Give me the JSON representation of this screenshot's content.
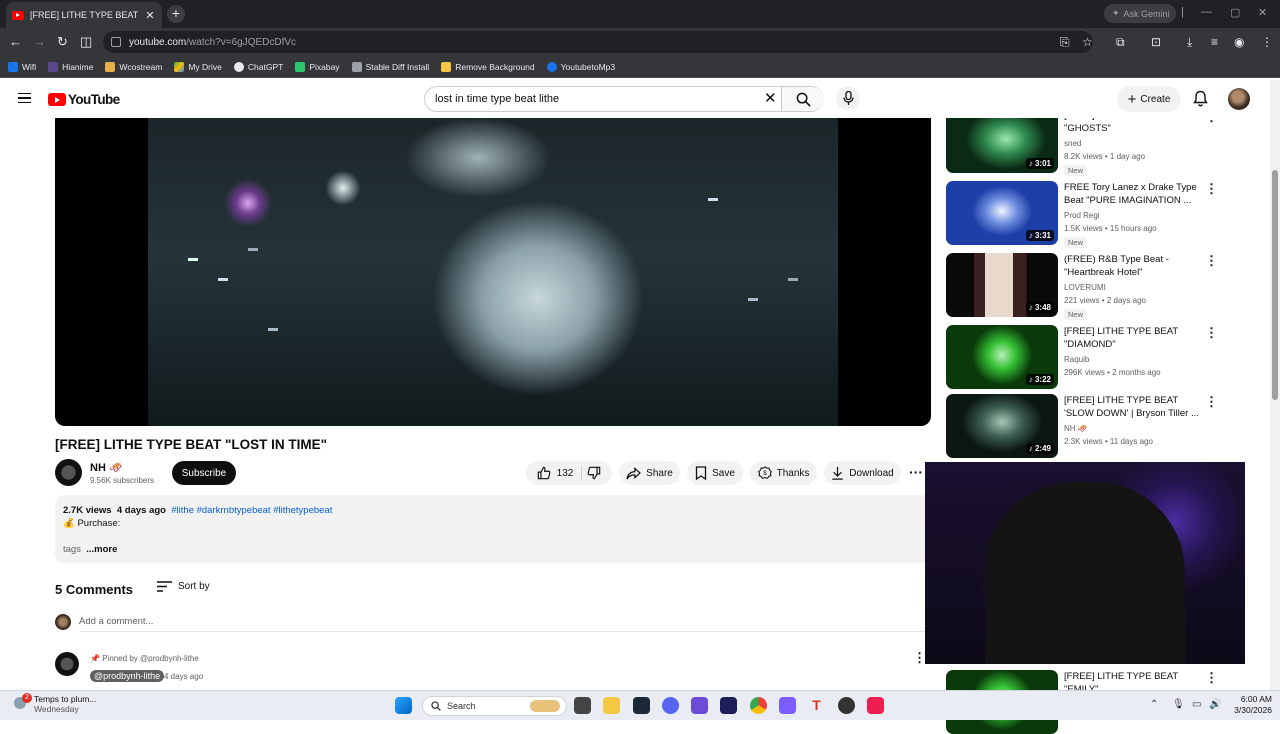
{
  "browser": {
    "tab_title": "[FREE] LITHE TYPE BEAT \"LOST IN",
    "new_tab": "+",
    "gemini_label": "Ask Gemini",
    "url_host": "youtube.com",
    "url_path": "/watch?v=6gJQEDcDfVc",
    "bookmarks": [
      "Wifi",
      "Hianime",
      "Wcostream",
      "My Drive",
      "ChatGPT",
      "Pixabay",
      "Stable Diff Install",
      "Remove Background",
      "YoutubetoMp3"
    ]
  },
  "youtube": {
    "logo_text": "YouTube",
    "search_value": "lost in time type beat lithe",
    "create_label": "Create"
  },
  "video": {
    "title": "[FREE] LITHE TYPE BEAT \"LOST IN TIME\"",
    "channel_name": "NH 🛷",
    "subscribers": "9.56K subscribers",
    "subscribe_label": "Subscribe",
    "likes": "132",
    "share_label": "Share",
    "save_label": "Save",
    "thanks_label": "Thanks",
    "download_label": "Download"
  },
  "description": {
    "views": "2.7K views",
    "date": "4 days ago",
    "hashtags": "#lithe #darkrnbtypebeat #lithetypebeat",
    "purchase": "💰 Purchase:",
    "tags": "tags",
    "more": "...more"
  },
  "comments": {
    "header": "5 Comments",
    "sort_label": "Sort by",
    "add_placeholder": "Add a comment...",
    "pinned_by": "Pinned by @prodbynh-lithe",
    "pinned_author": "@prodbynh-lithe",
    "pinned_date": "4 days ago"
  },
  "recommendations": [
    {
      "title": "[FREE] LITHE TYPE BEAT \"GHOSTS\"",
      "channel": "sned",
      "meta": "8.2K views • 1 day ago",
      "duration": "3:01",
      "badge": "New"
    },
    {
      "title": "FREE Tory Lanez x Drake Type Beat \"PURE IMAGINATION ...",
      "channel": "Prod Regi",
      "meta": "1.5K views • 15 hours ago",
      "duration": "3:31",
      "badge": "New"
    },
    {
      "title": "(FREE) R&B Type Beat - \"Heartbreak Hotel\"",
      "channel": "LOVERUMI",
      "meta": "221 views • 2 days ago",
      "duration": "3:48",
      "badge": "New"
    },
    {
      "title": "[FREE] LITHE TYPE BEAT \"DIAMOND\"",
      "channel": "Raquib",
      "meta": "296K views • 2 months ago",
      "duration": "3:22",
      "badge": ""
    },
    {
      "title": "[FREE] LITHE TYPE BEAT 'SLOW DOWN' | Bryson Tiller ...",
      "channel": "NH 🛷",
      "meta": "2.3K views • 11 days ago",
      "duration": "2:49",
      "badge": ""
    },
    {
      "title": "[FREE] LITHE TYPE BEAT \"EMILY\"",
      "channel": "",
      "meta": "",
      "duration": "",
      "badge": ""
    }
  ],
  "taskbar": {
    "weather_title": "Temps to plum...",
    "weather_sub": "Wednesday",
    "notification_count": "2",
    "search_label": "Search",
    "time": "6:00 AM",
    "date": "3/30/2026"
  }
}
